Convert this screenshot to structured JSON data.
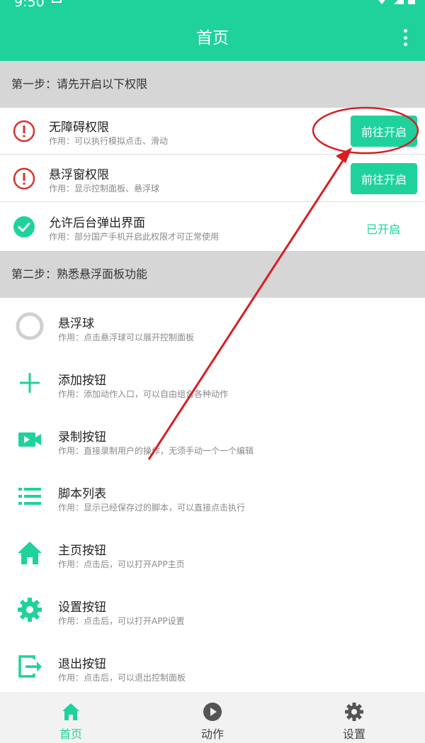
{
  "status_bar": {
    "time": "9:50"
  },
  "header": {
    "title": "首页"
  },
  "step1": {
    "title": "第一步：请先开启以下权限",
    "items": [
      {
        "title": "无障碍权限",
        "desc": "作用：可以执行模拟点击、滑动",
        "action": "前往开启"
      },
      {
        "title": "悬浮窗权限",
        "desc": "作用：显示控制面板、悬浮球",
        "action": "前往开启"
      },
      {
        "title": "允许后台弹出界面",
        "desc": "作用：部分国产手机开启此权限才可正常使用",
        "status": "已开启"
      }
    ]
  },
  "step2": {
    "title": "第二步：熟悉悬浮面板功能",
    "items": [
      {
        "title": "悬浮球",
        "desc": "作用：点击悬浮球可以展开控制面板",
        "icon": "circle-icon"
      },
      {
        "title": "添加按钮",
        "desc": "作用：添加动作入口，可以自由组合各种动作",
        "icon": "plus-icon"
      },
      {
        "title": "录制按钮",
        "desc": "作用：直接录制用户的操作，无须手动一个一个编辑",
        "icon": "video-camera-icon"
      },
      {
        "title": "脚本列表",
        "desc": "作用：显示已经保存过的脚本，可以直接点击执行",
        "icon": "list-icon"
      },
      {
        "title": "主页按钮",
        "desc": "作用：点击后，可以打开APP主页",
        "icon": "home-icon"
      },
      {
        "title": "设置按钮",
        "desc": "作用：点击后，可以打开APP设置",
        "icon": "gear-icon"
      },
      {
        "title": "退出按钮",
        "desc": "作用：点击后，可以退出控制面板",
        "icon": "exit-icon"
      }
    ]
  },
  "bottom_nav": [
    {
      "label": "首页",
      "icon": "home-icon",
      "active": true
    },
    {
      "label": "动作",
      "icon": "play-icon",
      "active": false
    },
    {
      "label": "设置",
      "icon": "gear-icon",
      "active": false
    }
  ],
  "colors": {
    "accent": "#1fd29c",
    "warning": "#d8322f",
    "annotation": "#d81e23"
  }
}
